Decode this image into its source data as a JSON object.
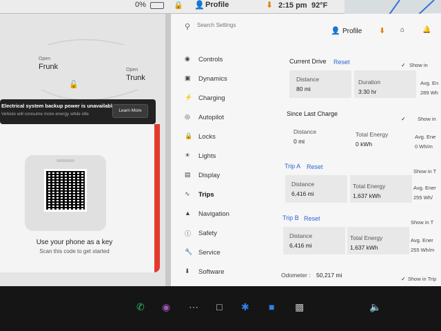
{
  "status_bar": {
    "battery_pct": "0%",
    "profile_label": "Profile",
    "time": "2:15 pm",
    "temperature": "92°F"
  },
  "car": {
    "frunk_open": "Open",
    "frunk_label": "Frunk",
    "trunk_open": "Open",
    "trunk_label": "Trunk"
  },
  "notice": {
    "title": "Electrical system backup power is unavailable",
    "subtitle": "Vehicle will consume more energy while idle",
    "learn_more": "Learn More"
  },
  "phone_key": {
    "title": "Use your phone as a key",
    "subtitle": "Scan this code to get started"
  },
  "settings": {
    "search_placeholder": "Search Settings",
    "profile_label": "Profile",
    "nav": [
      {
        "label": "Controls",
        "icon": "toggle-icon"
      },
      {
        "label": "Dynamics",
        "icon": "car-icon"
      },
      {
        "label": "Charging",
        "icon": "bolt-icon"
      },
      {
        "label": "Autopilot",
        "icon": "steering-wheel-icon"
      },
      {
        "label": "Locks",
        "icon": "lock-icon"
      },
      {
        "label": "Lights",
        "icon": "lightbulb-icon"
      },
      {
        "label": "Display",
        "icon": "display-icon"
      },
      {
        "label": "Trips",
        "icon": "trips-icon"
      },
      {
        "label": "Navigation",
        "icon": "navigation-arrow-icon"
      },
      {
        "label": "Safety",
        "icon": "info-circle-icon"
      },
      {
        "label": "Service",
        "icon": "wrench-icon"
      },
      {
        "label": "Software",
        "icon": "download-icon"
      }
    ],
    "active_nav": "Trips",
    "current_drive": {
      "title": "Current Drive",
      "reset": "Reset",
      "distance_label": "Distance",
      "distance_value": "80 mi",
      "duration_label": "Duration",
      "duration_value": "3:30 hr"
    },
    "since_last_charge": {
      "title": "Since Last Charge",
      "distance_label": "Distance",
      "distance_value": "0 mi",
      "energy_label": "Total Energy",
      "energy_value": "0 kWh"
    },
    "trip_a": {
      "title": "Trip A",
      "reset": "Reset",
      "distance_label": "Distance",
      "distance_value": "6,416 mi",
      "energy_label": "Total Energy",
      "energy_value": "1,637 kWh"
    },
    "trip_b": {
      "title": "Trip B",
      "reset": "Reset",
      "distance_label": "Distance",
      "distance_value": "6,416 mi",
      "energy_label": "Total Energy",
      "energy_value": "1,637 kWh"
    },
    "odometer_label": "Odometer :",
    "odometer_value": "50,217 mi",
    "side": {
      "show1": "Show in",
      "avg1_label": "Avg. En",
      "avg1_value": "289 Wh",
      "show2": "Show in",
      "avg2_label": "Avg. Ene",
      "avg2_value": "0 Wh/m",
      "show3": "Show in T",
      "avg3_label": "Avg. Ener",
      "avg3_value": "255 Wh/",
      "show4": "Show in T",
      "avg4_label": "Avg. Ener",
      "avg4_value": "255 Wh/m",
      "show5": "Show in Trip"
    }
  },
  "colors": {
    "accent_blue": "#2c62d8",
    "alert_red": "#e23a2e",
    "download_orange": "#e07b00"
  }
}
